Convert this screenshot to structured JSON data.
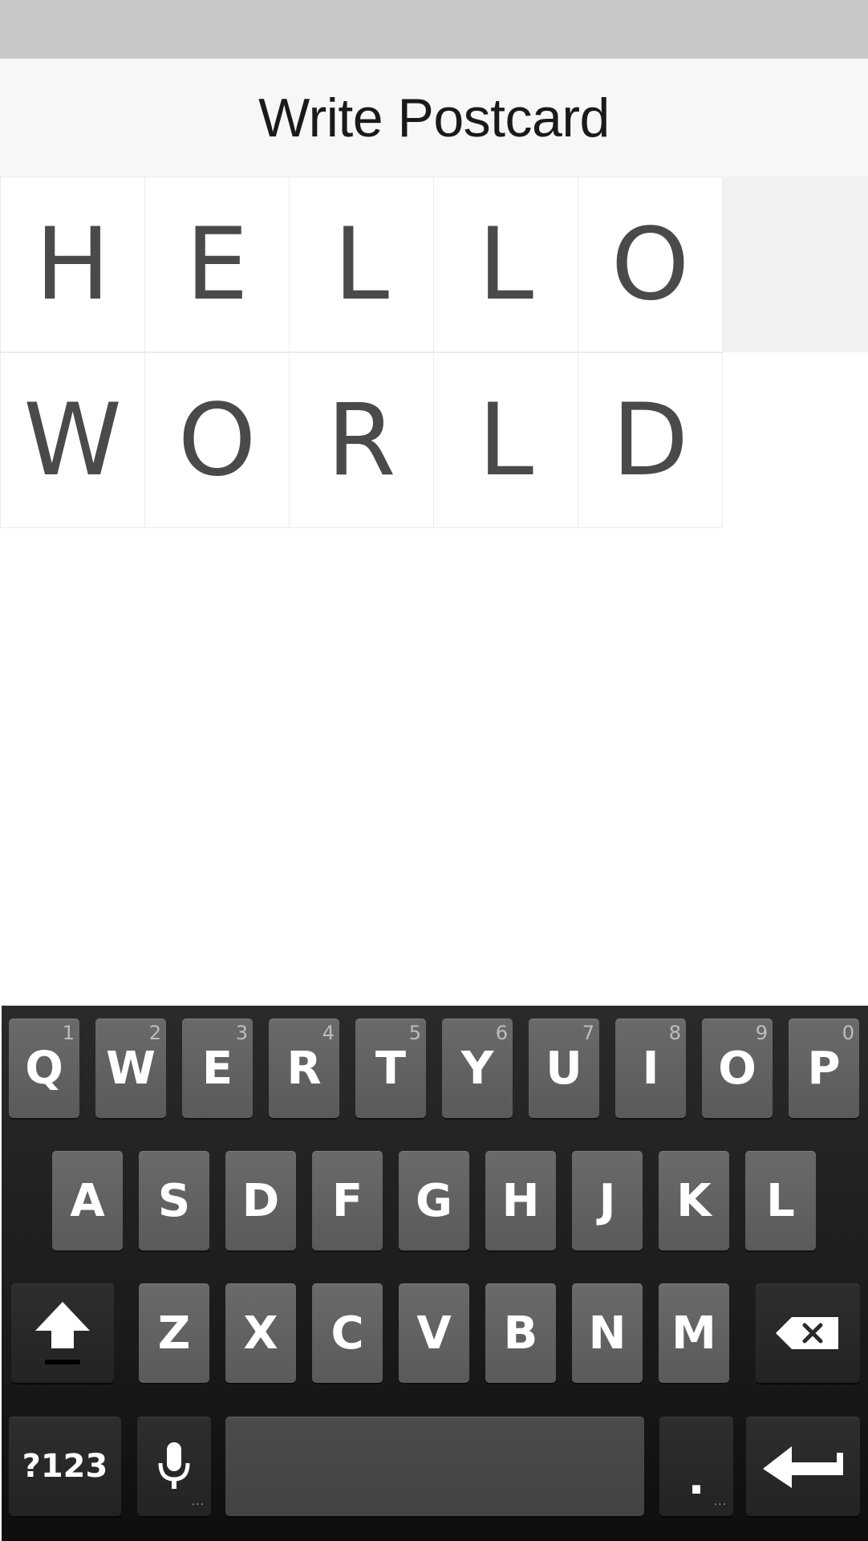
{
  "header": {
    "title": "Write Postcard"
  },
  "postcard": {
    "rows": [
      [
        "H",
        "E",
        "L",
        "L",
        "O"
      ],
      [
        "W",
        "O",
        "R",
        "L",
        "D"
      ]
    ]
  },
  "keyboard": {
    "row1": [
      {
        "label": "Q",
        "hint": "1"
      },
      {
        "label": "W",
        "hint": "2"
      },
      {
        "label": "E",
        "hint": "3"
      },
      {
        "label": "R",
        "hint": "4"
      },
      {
        "label": "T",
        "hint": "5"
      },
      {
        "label": "Y",
        "hint": "6"
      },
      {
        "label": "U",
        "hint": "7"
      },
      {
        "label": "I",
        "hint": "8"
      },
      {
        "label": "O",
        "hint": "9"
      },
      {
        "label": "P",
        "hint": "0"
      }
    ],
    "row2": [
      "A",
      "S",
      "D",
      "F",
      "G",
      "H",
      "J",
      "K",
      "L"
    ],
    "row3": [
      "Z",
      "X",
      "C",
      "V",
      "B",
      "N",
      "M"
    ],
    "symbols_label": "?123",
    "period_label": ".",
    "shift_icon": "shift-arrow-icon",
    "backspace_icon": "backspace-icon",
    "mic_icon": "microphone-icon",
    "enter_icon": "enter-arrow-icon"
  },
  "colors": {
    "status_bar": "#c8c8c8",
    "title_bar": "#f7f7f7",
    "tile_text": "#4a4a4a",
    "key_face": "#5e5e5e",
    "keyboard_bg": "#1b1b1b"
  }
}
